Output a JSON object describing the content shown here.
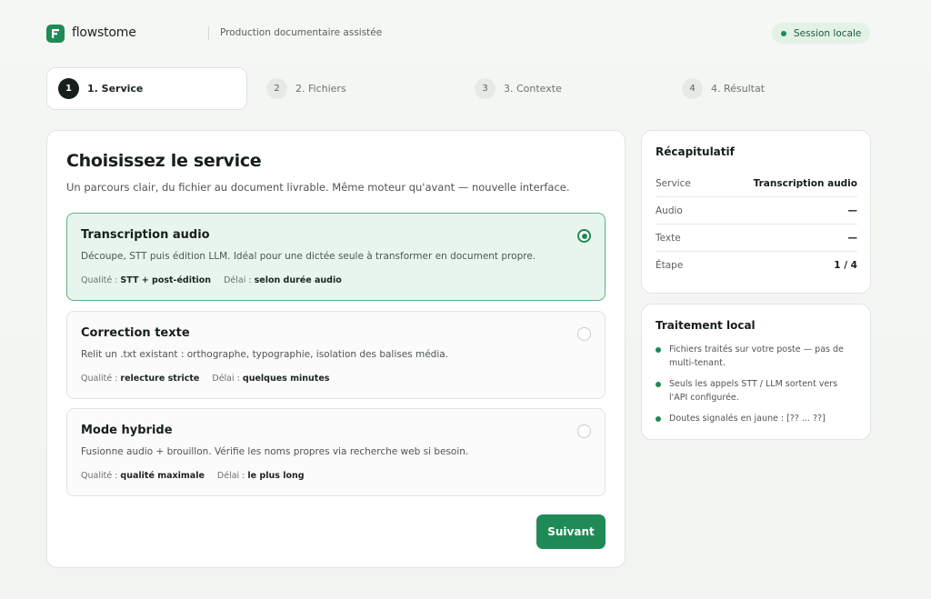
{
  "header": {
    "brand": "flowstome",
    "tagline": "Production documentaire assistée",
    "session_label": "Session locale"
  },
  "steps": [
    {
      "num": "1",
      "label": "1. Service",
      "active": true
    },
    {
      "num": "2",
      "label": "2. Fichiers",
      "active": false
    },
    {
      "num": "3",
      "label": "3. Contexte",
      "active": false
    },
    {
      "num": "4",
      "label": "4. Résultat",
      "active": false
    }
  ],
  "main": {
    "title": "Choisissez le service",
    "subtitle": "Un parcours clair, du fichier au document livrable. Même moteur qu'avant — nouvelle interface.",
    "options": [
      {
        "title": "Transcription audio",
        "desc": "Découpe, STT puis édition LLM. Idéal pour une dictée seule à transformer en document propre.",
        "quality_label": "Qualité :",
        "quality_value": "STT + post-édition",
        "delay_label": "Délai :",
        "delay_value": "selon durée audio",
        "selected": true
      },
      {
        "title": "Correction texte",
        "desc": "Relit un .txt existant : orthographe, typographie, isolation des balises média.",
        "quality_label": "Qualité :",
        "quality_value": "relecture stricte",
        "delay_label": "Délai :",
        "delay_value": "quelques minutes",
        "selected": false
      },
      {
        "title": "Mode hybride",
        "desc": "Fusionne audio + brouillon. Vérifie les noms propres via recherche web si besoin.",
        "quality_label": "Qualité :",
        "quality_value": "qualité maximale",
        "delay_label": "Délai :",
        "delay_value": "le plus long",
        "selected": false
      }
    ],
    "next_label": "Suivant"
  },
  "summary": {
    "title": "Récapitulatif",
    "rows": [
      {
        "key": "Service",
        "value": "Transcription audio"
      },
      {
        "key": "Audio",
        "value": "—"
      },
      {
        "key": "Texte",
        "value": "—"
      },
      {
        "key": "Étape",
        "value": "1 / 4"
      }
    ]
  },
  "local": {
    "title": "Traitement local",
    "bullets": [
      "Fichiers traités sur votre poste — pas de multi-tenant.",
      "Seuls les appels STT / LLM sortent vers l'API configurée.",
      "Doutes signalés en jaune : [?? ... ??]"
    ]
  },
  "colors": {
    "accent": "#1f8a55",
    "selected_bg": "#e8f5ec",
    "selected_border": "#5fb083"
  }
}
